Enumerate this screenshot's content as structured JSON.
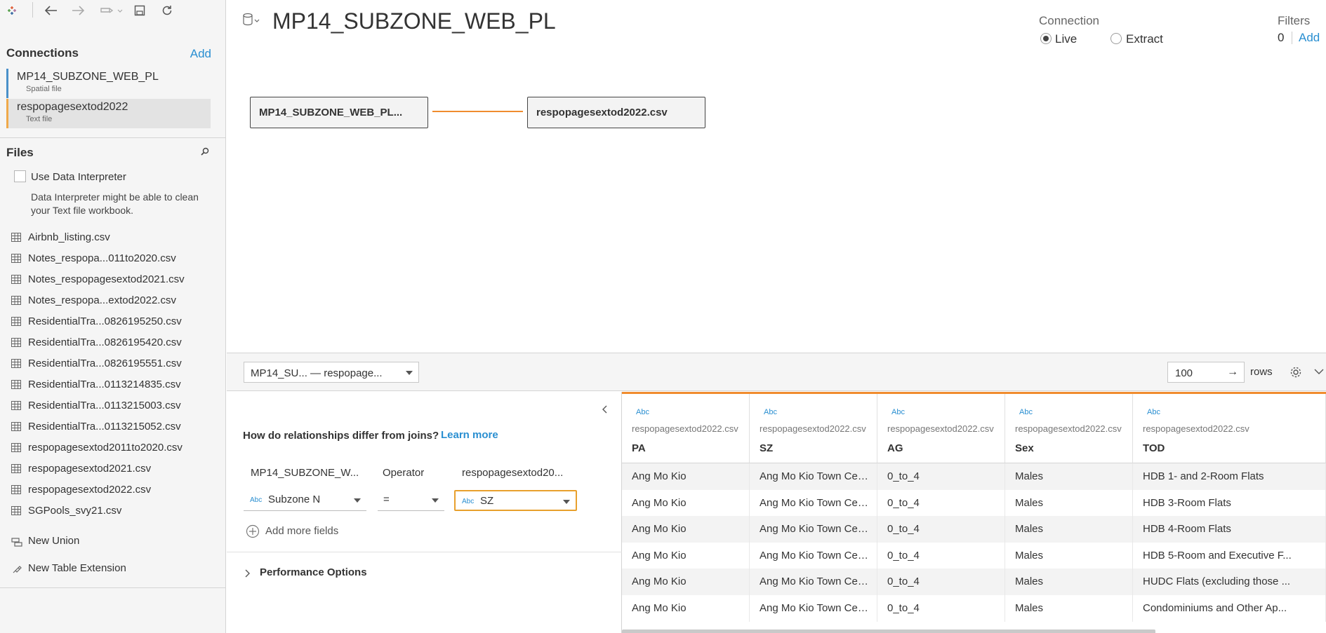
{
  "toolbar": {
    "icons": [
      "tableau-logo-icon",
      "back-arrow-icon",
      "forward-arrow-icon",
      "redo-menu-icon",
      "save-icon",
      "refresh-icon"
    ]
  },
  "sidebar": {
    "connections_title": "Connections",
    "connections_add": "Add",
    "connections": [
      {
        "name": "MP14_SUBZONE_WEB_PL",
        "type": "Spatial file",
        "color": "#4a90c9"
      },
      {
        "name": "respopagesextod2022",
        "type": "Text file",
        "color": "#f0a94a"
      }
    ],
    "files_title": "Files",
    "data_interpreter": {
      "label": "Use Data Interpreter",
      "note": "Data Interpreter might be able to clean your Text file workbook."
    },
    "files": [
      "Airbnb_listing.csv",
      "Notes_respopa...011to2020.csv",
      "Notes_respopagesextod2021.csv",
      "Notes_respopa...extod2022.csv",
      "ResidentialTra...0826195250.csv",
      "ResidentialTra...0826195420.csv",
      "ResidentialTra...0826195551.csv",
      "ResidentialTra...0113214835.csv",
      "ResidentialTra...0113215003.csv",
      "ResidentialTra...0113215052.csv",
      "respopagesextod2011to2020.csv",
      "respopagesextod2021.csv",
      "respopagesextod2022.csv",
      "SGPools_svy21.csv"
    ],
    "new_union": "New Union",
    "new_table_extension": "New Table Extension"
  },
  "canvas": {
    "title": "MP14_SUBZONE_WEB_PL",
    "connection_label": "Connection",
    "live_label": "Live",
    "extract_label": "Extract",
    "connection_mode": "Live",
    "filters_label": "Filters",
    "filters_count": "0",
    "filters_add": "Add",
    "tables": [
      "MP14_SUBZONE_WEB_PL...",
      "respopagesextod2022.csv"
    ],
    "relation_color": "#f08c2e"
  },
  "bottom_bar": {
    "table_selector": "MP14_SU...   —  respopage...",
    "rows_value": "100",
    "rows_go": "→",
    "rows_label": "rows"
  },
  "join_panel": {
    "question": "How do relationships differ from joins?",
    "learn_more": "Learn more",
    "left_table": "MP14_SUBZONE_W...",
    "operator_label": "Operator",
    "right_table": "respopagesextod20...",
    "left_field": "Subzone N",
    "operator": "=",
    "right_field": "SZ",
    "field_type": "Abc",
    "add_more_fields": "Add more fields",
    "performance_options": "Performance Options"
  },
  "grid": {
    "columns": [
      {
        "type": "Abc",
        "source": "respopagesextod2022.csv",
        "name": "PA"
      },
      {
        "type": "Abc",
        "source": "respopagesextod2022.csv",
        "name": "SZ"
      },
      {
        "type": "Abc",
        "source": "respopagesextod2022.csv",
        "name": "AG"
      },
      {
        "type": "Abc",
        "source": "respopagesextod2022.csv",
        "name": "Sex"
      },
      {
        "type": "Abc",
        "source": "respopagesextod2022.csv",
        "name": "TOD"
      }
    ],
    "rows": [
      [
        "Ang Mo Kio",
        "Ang Mo Kio Town Centre",
        "0_to_4",
        "Males",
        "HDB 1- and 2-Room Flats"
      ],
      [
        "Ang Mo Kio",
        "Ang Mo Kio Town Centre",
        "0_to_4",
        "Males",
        "HDB 3-Room Flats"
      ],
      [
        "Ang Mo Kio",
        "Ang Mo Kio Town Centre",
        "0_to_4",
        "Males",
        "HDB 4-Room Flats"
      ],
      [
        "Ang Mo Kio",
        "Ang Mo Kio Town Centre",
        "0_to_4",
        "Males",
        "HDB 5-Room and Executive F..."
      ],
      [
        "Ang Mo Kio",
        "Ang Mo Kio Town Centre",
        "0_to_4",
        "Males",
        "HUDC Flats (excluding those ..."
      ],
      [
        "Ang Mo Kio",
        "Ang Mo Kio Town Centre",
        "0_to_4",
        "Males",
        "Condominiums and Other Ap..."
      ]
    ]
  }
}
